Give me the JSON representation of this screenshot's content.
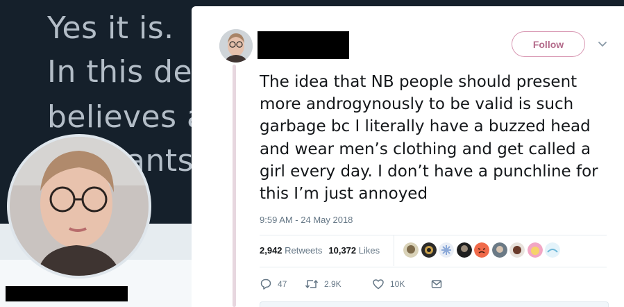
{
  "background": {
    "bio_lines": [
      "Yes it is.",
      "In this de",
      "believes a",
      "ants"
    ]
  },
  "tweet": {
    "follow_label": "Follow",
    "text": "The idea that NB people should present more androgynously to be valid is such garbage bc I literally have a buzzed head and wear men’s clothing and get called a girl every day. I don’t have a punchline for this I’m just annoyed",
    "timestamp": "9:59 AM - 24 May 2018",
    "retweets_count": "2,942",
    "retweets_label": "Retweets",
    "likes_count": "10,372",
    "likes_label": "Likes",
    "reply_count": "47",
    "retweet_count_short": "2.9K",
    "like_count_short": "10K"
  },
  "colors": {
    "accent": "#b36a8a",
    "background_header": "#15202b",
    "text_muted": "#657786"
  },
  "icons": [
    "chevron-down-icon",
    "reply-icon",
    "retweet-icon",
    "heart-icon",
    "message-icon"
  ]
}
